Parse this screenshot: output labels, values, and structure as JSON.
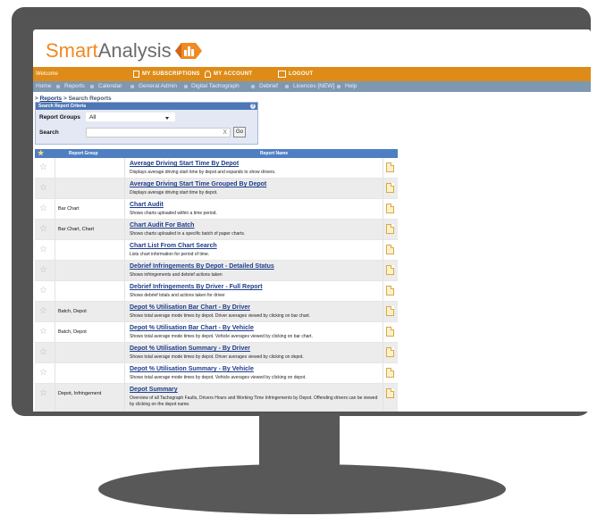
{
  "app": {
    "logo_smart": "Smart",
    "logo_analysis": "Analysis"
  },
  "topbar": {
    "welcome": "Welcome",
    "subscriptions": "MY SUBSCRIPTIONS",
    "account": "MY ACCOUNT",
    "logout": "LOGOUT"
  },
  "nav": {
    "items": [
      "Home",
      "Reports",
      "Calendar",
      "General Admin",
      "Digital Tachograph",
      "Debrief",
      "Licences [NEW]",
      "Help"
    ]
  },
  "breadcrumb": {
    "prefix": ">",
    "reports": "Reports",
    "current": "> Search Reports"
  },
  "criteria": {
    "title": "Search Report Criteria",
    "help": "?",
    "groups_label": "Report Groups",
    "groups_value": "All",
    "search_label": "Search",
    "search_value": "",
    "clear": "X",
    "go": "Go"
  },
  "results": {
    "col_group": "Report Group",
    "col_name": "Report Name",
    "rows": [
      {
        "group": "",
        "title": "Average Driving Start Time By Depot",
        "desc": "Displays average driving start time by depot and expands to show drivers."
      },
      {
        "group": "",
        "title": "Average Driving Start Time Grouped By Depot",
        "desc": "Displays average driving start time by depot."
      },
      {
        "group": "Bar Chart",
        "title": "Chart Audit",
        "desc": "Shows charts uploaded within a time period."
      },
      {
        "group": "Bar Chart, Chart",
        "title": "Chart Audit For Batch",
        "desc": "Shows charts uploaded in a specific batch of paper charts."
      },
      {
        "group": "",
        "title": "Chart List From Chart Search",
        "desc": "Lists chart information for period of time."
      },
      {
        "group": "",
        "title": "Debrief Infringements By Depot - Detailed Status",
        "desc": "Shows infringements and debrief actions taken"
      },
      {
        "group": "",
        "title": "Debrief Infringements By Driver - Full Report",
        "desc": "Shows debrief totals and actions taken for driver"
      },
      {
        "group": "Batch, Depot",
        "title": "Depot % Utilisation Bar Chart - By Driver",
        "desc": "Shows total average mode times by depot. Driver averages viewed by clicking on bar chart."
      },
      {
        "group": "Batch, Depot",
        "title": "Depot % Utilisation Bar Chart - By Vehicle",
        "desc": "Shows total average mode times by depot. Vehicle averages viewed by clicking on bar chart."
      },
      {
        "group": "",
        "title": "Depot % Utilisation Summary - By Driver",
        "desc": "Shows total average mode times by depot. Driver averages viewed by clicking on depot."
      },
      {
        "group": "",
        "title": "Depot % Utilisation Summary - By Vehicle",
        "desc": "Shows total average mode times by depot. Vehicle averages viewed by clicking on depot."
      },
      {
        "group": "Depot, Infringement",
        "title": "Depot Summary",
        "desc": "Overview of all Tachograph Faults, Drivers Hours and Working Time Infringements by Depot. Offending drivers can be viewed by clicking on the depot name."
      }
    ]
  },
  "colors": {
    "brand_orange": "#f08a22",
    "topbar": "#de8b17",
    "navbar": "#7f98b1",
    "table_header": "#4e7fc3",
    "link": "#1e3d8a"
  }
}
